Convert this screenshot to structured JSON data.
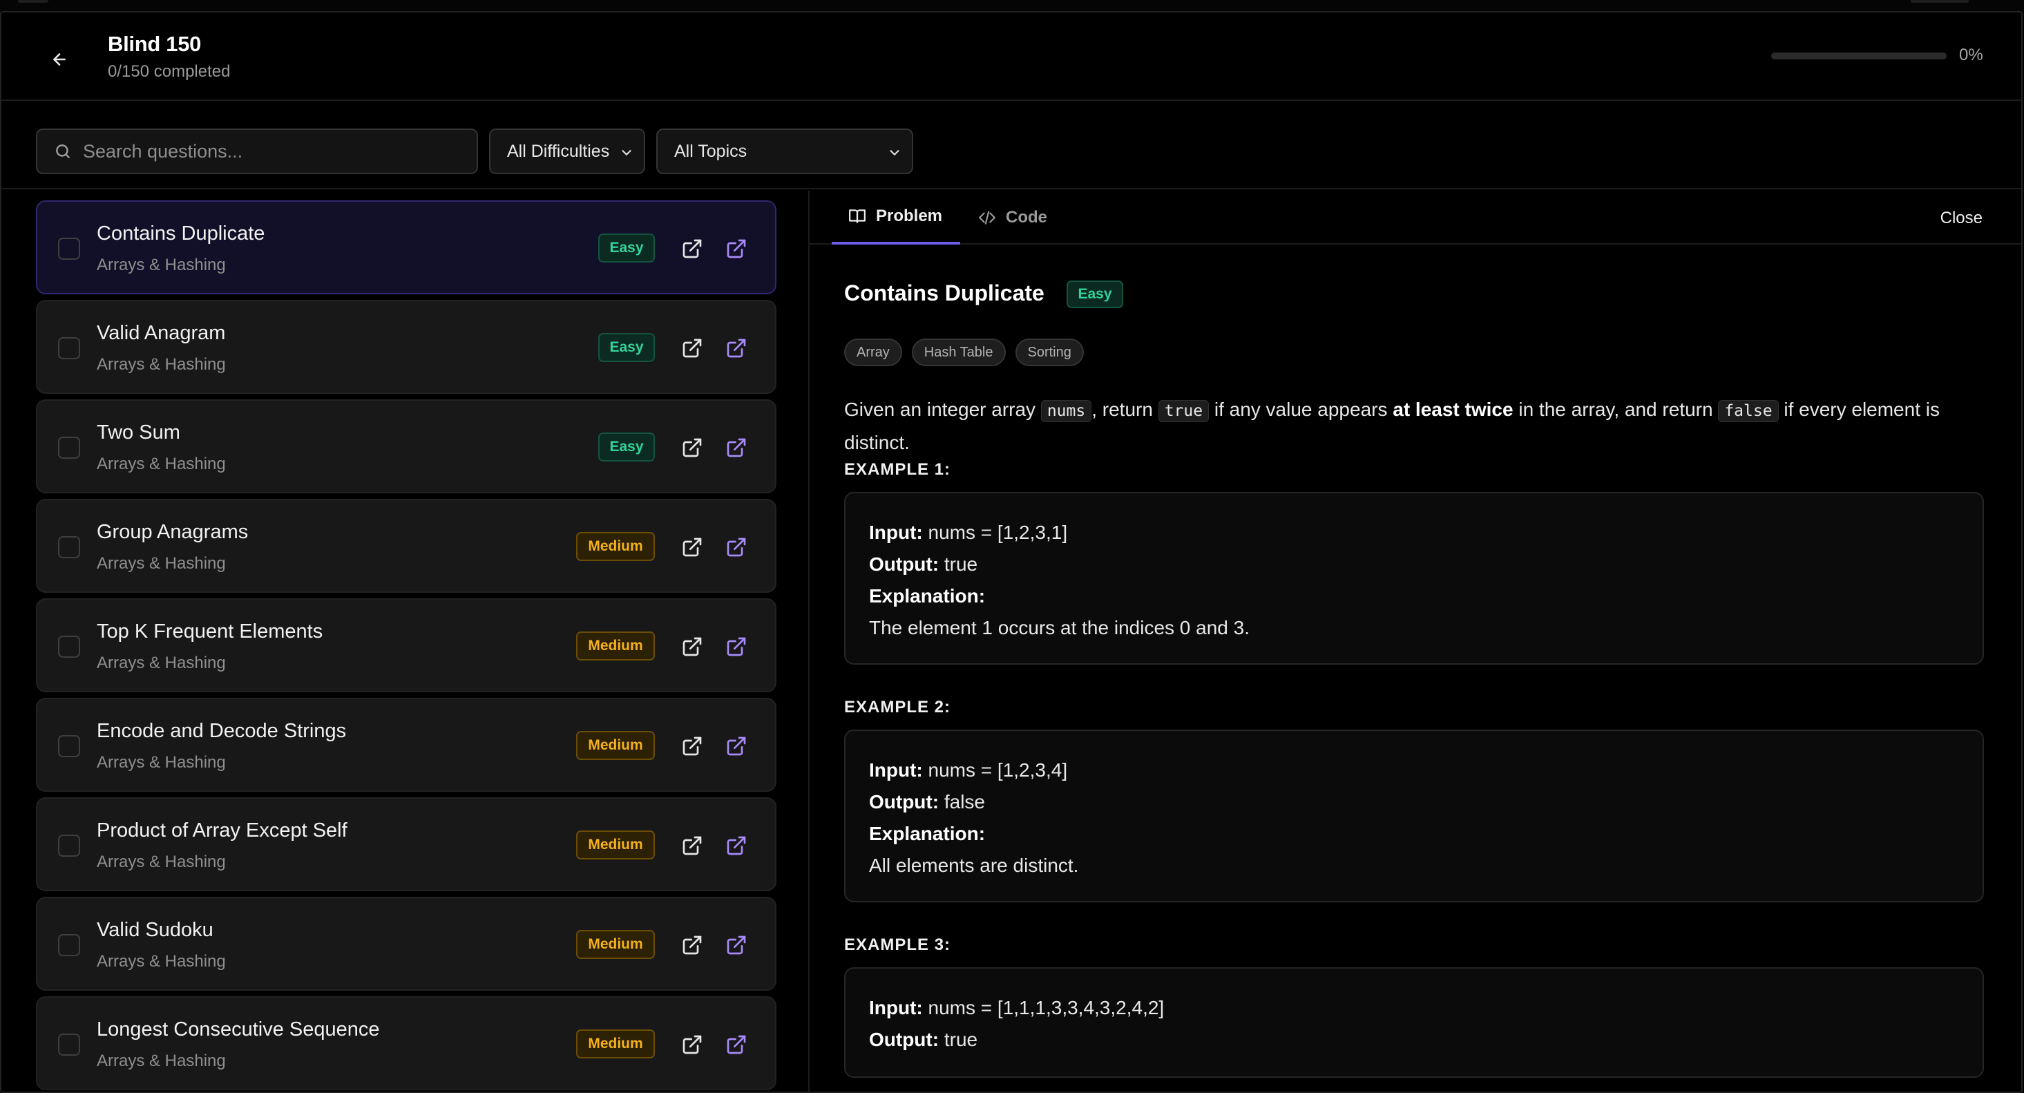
{
  "header": {
    "title": "Blind 150",
    "subtitle": "0/150 completed",
    "progress_percent": 0,
    "progress_text": "0%"
  },
  "filters": {
    "search_placeholder": "Search questions...",
    "difficulty": "All Difficulties",
    "topic": "All Topics"
  },
  "questions": [
    {
      "title": "Contains Duplicate",
      "topic": "Arrays & Hashing",
      "difficulty": "Easy",
      "active": true
    },
    {
      "title": "Valid Anagram",
      "topic": "Arrays & Hashing",
      "difficulty": "Easy"
    },
    {
      "title": "Two Sum",
      "topic": "Arrays & Hashing",
      "difficulty": "Easy"
    },
    {
      "title": "Group Anagrams",
      "topic": "Arrays & Hashing",
      "difficulty": "Medium"
    },
    {
      "title": "Top K Frequent Elements",
      "topic": "Arrays & Hashing",
      "difficulty": "Medium"
    },
    {
      "title": "Encode and Decode Strings",
      "topic": "Arrays & Hashing",
      "difficulty": "Medium"
    },
    {
      "title": "Product of Array Except Self",
      "topic": "Arrays & Hashing",
      "difficulty": "Medium"
    },
    {
      "title": "Valid Sudoku",
      "topic": "Arrays & Hashing",
      "difficulty": "Medium"
    },
    {
      "title": "Longest Consecutive Sequence",
      "topic": "Arrays & Hashing",
      "difficulty": "Medium"
    }
  ],
  "detail": {
    "tabs": {
      "problem": "Problem",
      "code": "Code"
    },
    "close": "Close",
    "title": "Contains Duplicate",
    "difficulty": "Easy",
    "tags": [
      "Array",
      "Hash Table",
      "Sorting"
    ],
    "description": {
      "p1": "Given an integer array ",
      "c1": "nums",
      "p2": ", return ",
      "c2": "true",
      "p3": " if any value appears ",
      "b1": "at least twice",
      "p4": " in the array, and return ",
      "c3": "false",
      "p5": " if every element is distinct."
    },
    "labels": {
      "input": "Input:",
      "output": "Output:",
      "explanation": "Explanation:"
    },
    "examples": [
      {
        "label": "EXAMPLE 1:",
        "input": "nums = [1,2,3,1]",
        "output": "true",
        "explanation": "The element 1 occurs at the indices 0 and 3."
      },
      {
        "label": "EXAMPLE 2:",
        "input": "nums = [1,2,3,4]",
        "output": "false",
        "explanation": "All elements are distinct."
      },
      {
        "label": "EXAMPLE 3:",
        "input": "nums = [1,1,1,3,3,4,3,2,4,2]",
        "output": "true"
      }
    ]
  },
  "colors": {
    "accent": "#8b5cf6",
    "easy": "#34d399",
    "medium": "#f5b01c"
  }
}
